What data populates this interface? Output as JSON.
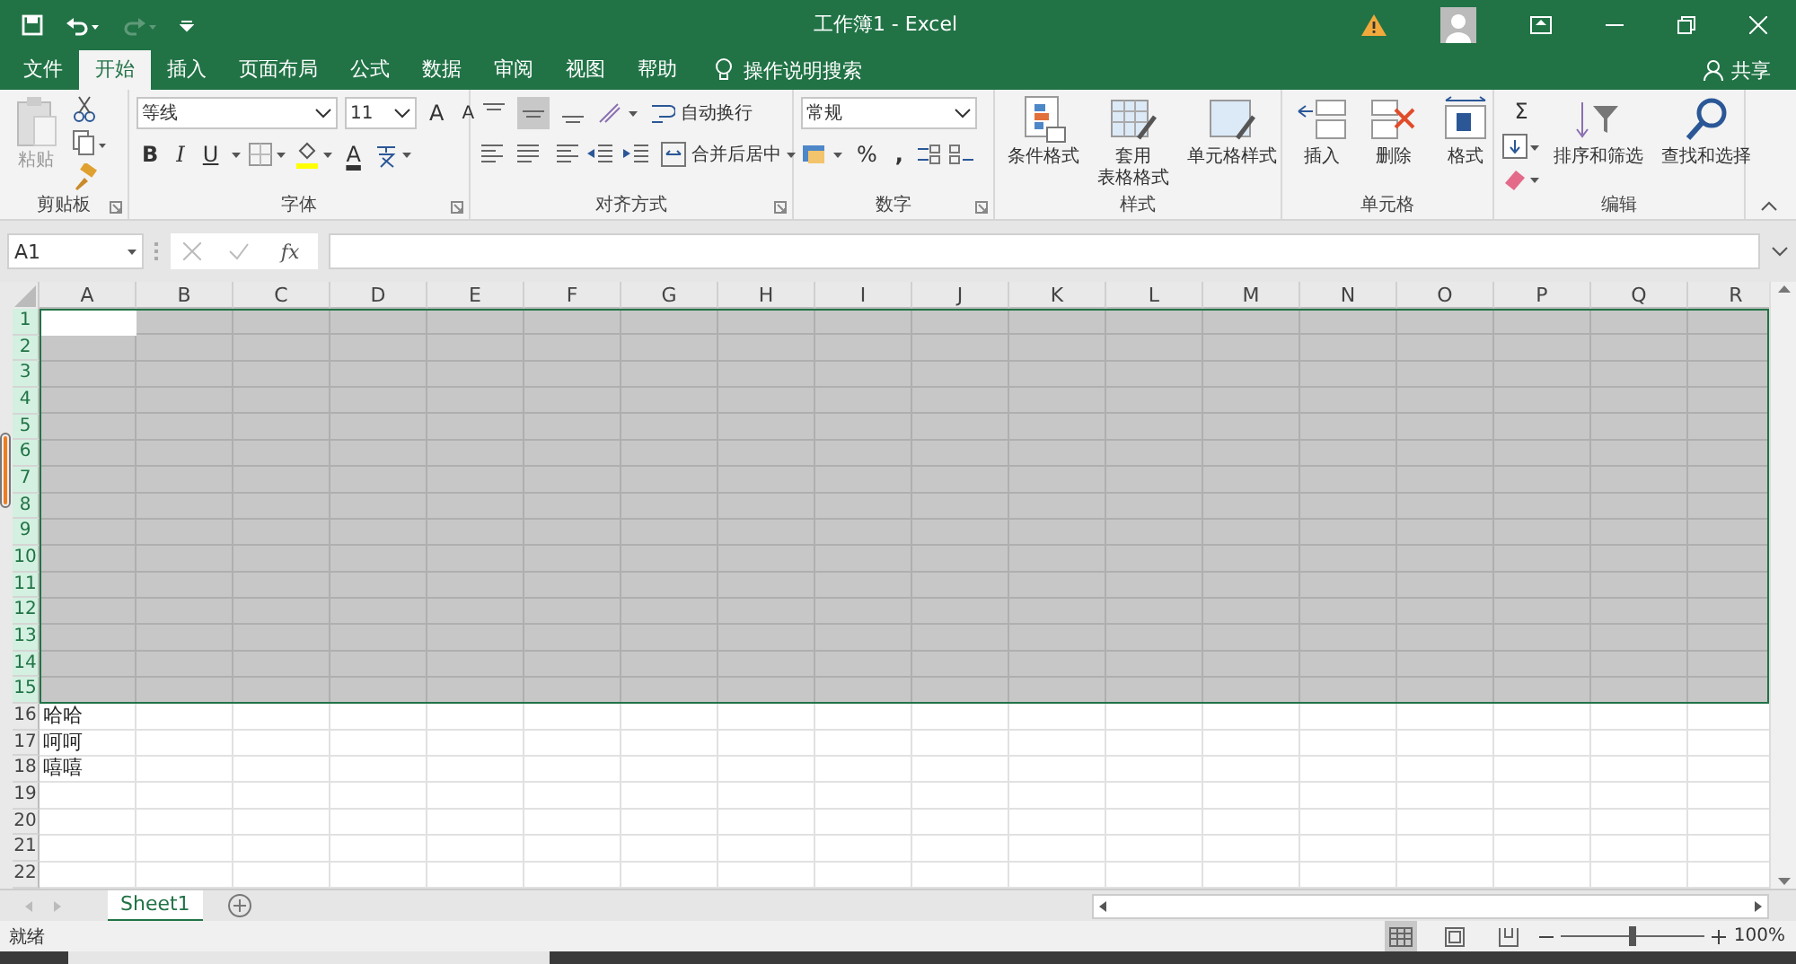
{
  "window": {
    "title": "工作簿1 - Excel",
    "redo_disabled": true
  },
  "tabs": [
    {
      "label": "文件",
      "selected": false
    },
    {
      "label": "开始",
      "selected": true
    },
    {
      "label": "插入",
      "selected": false
    },
    {
      "label": "页面布局",
      "selected": false
    },
    {
      "label": "公式",
      "selected": false
    },
    {
      "label": "数据",
      "selected": false
    },
    {
      "label": "审阅",
      "selected": false
    },
    {
      "label": "视图",
      "selected": false
    },
    {
      "label": "帮助",
      "selected": false
    }
  ],
  "tell_me": "操作说明搜索",
  "share": "共享",
  "ribbon": {
    "groups": [
      {
        "kind": "clipboard",
        "label": "剪贴板",
        "launcher": true,
        "paste": "粘贴"
      },
      {
        "kind": "font",
        "label": "字体",
        "launcher": true,
        "font": "等线",
        "size": "11",
        "grow": "A",
        "shrink": "A",
        "bold": "B",
        "italic": "I",
        "underline": "U",
        "font_color": "A"
      },
      {
        "kind": "alignment",
        "label": "对齐方式",
        "launcher": true,
        "wrap": "自动换行",
        "merge": "合并后居中",
        "vertical_align": [
          {
            "selected": false
          },
          {
            "selected": true
          },
          {
            "selected": false
          }
        ]
      },
      {
        "kind": "number",
        "label": "数字",
        "launcher": true,
        "format": "常规",
        "percent": "%",
        "comma": ","
      },
      {
        "kind": "styles",
        "label": "样式",
        "launcher": false,
        "buttons": [
          {
            "lines": [
              "条件格式"
            ]
          },
          {
            "lines": [
              "套用",
              "表格格式"
            ]
          },
          {
            "lines": [
              "单元格样式"
            ]
          }
        ]
      },
      {
        "kind": "cells",
        "label": "单元格",
        "launcher": false,
        "buttons": [
          {
            "lines": [
              "插入"
            ]
          },
          {
            "lines": [
              "删除"
            ]
          },
          {
            "lines": [
              "格式"
            ]
          }
        ]
      },
      {
        "kind": "editing",
        "label": "编辑",
        "launcher": false,
        "sum": "Σ",
        "buttons": [
          {
            "lines": [
              "排序和筛选"
            ]
          },
          {
            "lines": [
              "查找和选择"
            ]
          }
        ]
      }
    ]
  },
  "formula_bar": {
    "name_box": "A1",
    "fx": "fx"
  },
  "grid": {
    "columns": [
      "A",
      "B",
      "C",
      "D",
      "E",
      "F",
      "G",
      "H",
      "I",
      "J",
      "K",
      "L",
      "M",
      "N",
      "O",
      "P",
      "Q",
      "R"
    ],
    "rows": [
      {
        "number": "1",
        "selected": true,
        "active": true
      },
      {
        "number": "2",
        "selected": true,
        "active": false
      },
      {
        "number": "3",
        "selected": true,
        "active": false
      },
      {
        "number": "4",
        "selected": true,
        "active": false
      },
      {
        "number": "5",
        "selected": true,
        "active": false
      },
      {
        "number": "6",
        "selected": true,
        "active": false
      },
      {
        "number": "7",
        "selected": true,
        "active": false
      },
      {
        "number": "8",
        "selected": true,
        "active": false
      },
      {
        "number": "9",
        "selected": true,
        "active": false
      },
      {
        "number": "10",
        "selected": true,
        "active": false
      },
      {
        "number": "11",
        "selected": true,
        "active": false
      },
      {
        "number": "12",
        "selected": true,
        "active": false
      },
      {
        "number": "13",
        "selected": true,
        "active": false
      },
      {
        "number": "14",
        "selected": true,
        "active": false
      },
      {
        "number": "15",
        "selected": true,
        "active": false
      },
      {
        "number": "16",
        "selected": false,
        "active": false,
        "cells": [
          "哈哈"
        ]
      },
      {
        "number": "17",
        "selected": false,
        "active": false,
        "cells": [
          "呵呵"
        ]
      },
      {
        "number": "18",
        "selected": false,
        "active": false,
        "cells": [
          "嘻嘻"
        ]
      },
      {
        "number": "19",
        "selected": false,
        "active": false
      },
      {
        "number": "20",
        "selected": false,
        "active": false
      },
      {
        "number": "21",
        "selected": false,
        "active": false
      },
      {
        "number": "22",
        "selected": false,
        "active": false
      }
    ]
  },
  "sheets": [
    {
      "label": "Sheet1",
      "selected": true
    }
  ],
  "status_bar": {
    "status": "就绪",
    "views": [
      {
        "selected": true
      },
      {
        "selected": false
      },
      {
        "selected": false
      }
    ],
    "zoom": {
      "level": 0.5,
      "reading": "100%"
    }
  }
}
